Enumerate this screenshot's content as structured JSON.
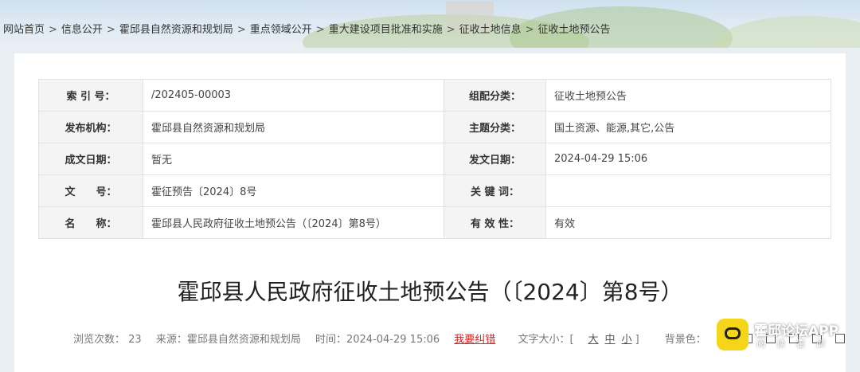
{
  "breadcrumb": [
    "网站首页",
    "信息公开",
    "霍邱县自然资源和规划局",
    "重点领域公开",
    "重大建设项目批准和实施",
    "征收土地信息",
    "征收土地预公告"
  ],
  "breadcrumb_sep": ">",
  "meta": {
    "rows": [
      {
        "k1": "索 引 号：",
        "v1": "/202405-00003",
        "k2": "组配分类：",
        "v2": "征收土地预公告"
      },
      {
        "k1": "发布机构：",
        "v1": "霍邱县自然资源和规划局",
        "k2": "主题分类：",
        "v2": "国土资源、能源,其它,公告"
      },
      {
        "k1": "成文日期：",
        "v1": "暂无",
        "k2": "发文日期：",
        "v2": "2024-04-29 15:06"
      },
      {
        "k1": "文　　号：",
        "v1": "霍征预告〔2024〕8号",
        "k2": "关 键 词：",
        "v2": ""
      },
      {
        "k1": "名　　称：",
        "v1": "霍邱县人民政府征收土地预公告（〔2024〕第8号）",
        "k2": "有 效 性：",
        "v2": "有效"
      }
    ]
  },
  "title": "霍邱县人民政府征收土地预公告（〔2024〕第8号）",
  "info": {
    "views": "浏览次数： 23",
    "source": "来源：霍邱县自然资源和规划局",
    "time": "时间：2024-04-29 15:06",
    "error_link": "我要纠错",
    "font_size_label": "文字大小：[",
    "font_size_options": [
      "大",
      "中",
      "小"
    ],
    "font_size_end": "]",
    "bg_label": "背景色："
  },
  "watermark": {
    "name": "霍邱论坛APP",
    "sub": "阅读霍邱"
  }
}
